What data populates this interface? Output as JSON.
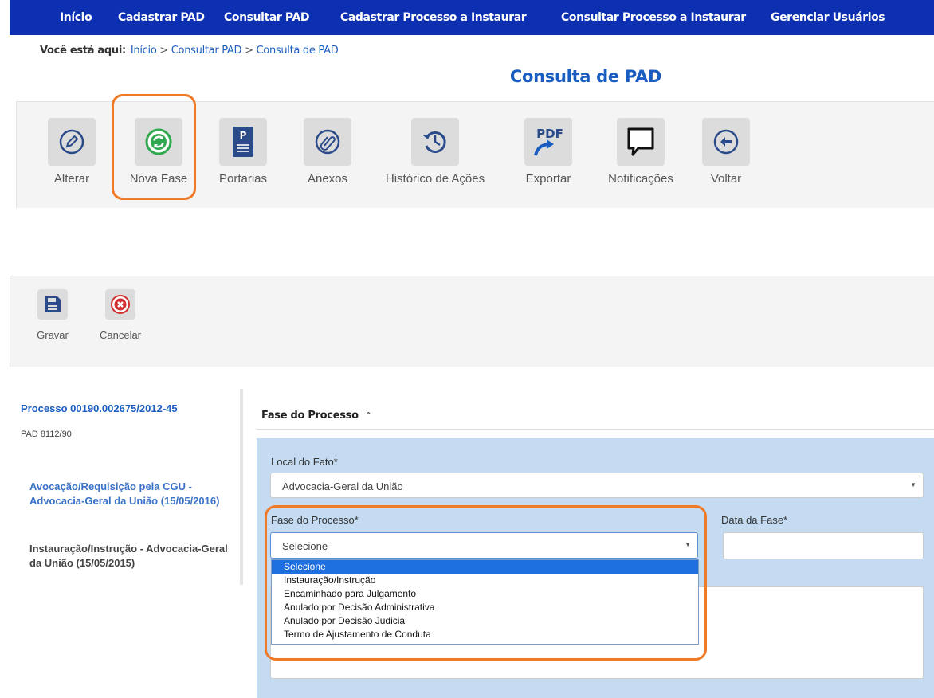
{
  "nav": {
    "items": [
      "Início",
      "Cadastrar PAD",
      "Consultar PAD",
      "Cadastrar Processo a Instaurar",
      "Consultar Processo a Instaurar",
      "Gerenciar Usuários"
    ]
  },
  "breadcrumb": {
    "prefix": "Você está aqui:",
    "items": [
      "Início",
      "Consultar PAD",
      "Consulta de PAD"
    ],
    "separator": ">"
  },
  "page": {
    "title": "Consulta de PAD"
  },
  "toolbar": {
    "items": [
      {
        "label": "Alterar",
        "icon": "pencil-icon"
      },
      {
        "label": "Nova Fase",
        "icon": "refresh-icon"
      },
      {
        "label": "Portarias",
        "icon": "document-p-icon"
      },
      {
        "label": "Anexos",
        "icon": "paperclip-icon"
      },
      {
        "label": "Histórico de Ações",
        "icon": "history-icon"
      },
      {
        "label": "Exportar",
        "icon": "pdf-export-icon",
        "icon_text": "PDF"
      },
      {
        "label": "Notificações",
        "icon": "speech-bubble-icon"
      },
      {
        "label": "Voltar",
        "icon": "arrow-left-icon"
      }
    ]
  },
  "form_toolbar": {
    "save_label": "Gravar",
    "cancel_label": "Cancelar"
  },
  "sidebar": {
    "process": "Processo 00190.002675/2012-45",
    "type": "PAD 8112/90",
    "phases": [
      "Avocação/Requisição pela CGU - Advocacia-Geral da União (15/05/2016)",
      "Instauração/Instrução - Advocacia-Geral da União (15/05/2015)"
    ]
  },
  "section": {
    "title": "Fase do Processo",
    "toggle": "⌃"
  },
  "form": {
    "local_label": "Local do Fato*",
    "local_value": "Advocacia-Geral da União",
    "fase_label": "Fase do Processo*",
    "fase_value": "Selecione",
    "data_label": "Data da Fase*",
    "fase_options": [
      "Selecione",
      "Instauração/Instrução",
      "Encaminhado para Julgamento",
      "Anulado por Decisão Administrativa",
      "Anulado por Decisão Judicial",
      "Termo de Ajustamento de Conduta"
    ],
    "selected_option": "Selecione"
  },
  "colors": {
    "nav_bg": "#0d2fb2",
    "title": "#1a5dc1",
    "highlight": "#f07a26",
    "panel_bg": "#c4dbf1",
    "option_selected": "#1e6fe0"
  }
}
